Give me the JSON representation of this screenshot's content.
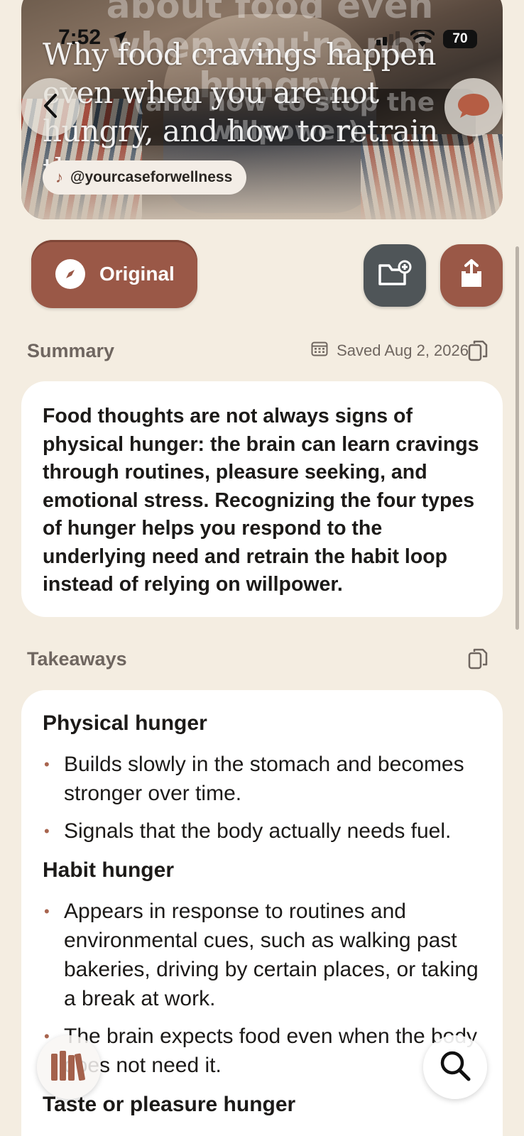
{
  "status_bar": {
    "time": "7:52",
    "battery": "70"
  },
  "hero": {
    "overlay_caption_top": "about food even when you're not hungry",
    "overlay_caption_bottom": "(and how to stop the willpower)",
    "title": "Why food cravings happen even when you are not hungry, and how to retrain them",
    "handle": "@yourcaseforwellness"
  },
  "actions": {
    "original_label": "Original"
  },
  "summary": {
    "heading": "Summary",
    "saved": "Saved Aug 2, 2026",
    "text": "Food thoughts are not always signs of physical hunger: the brain can learn cravings through routines, pleasure seeking, and emotional stress. Recognizing the four types of hunger helps you respond to the underlying need and retrain the habit loop instead of relying on willpower."
  },
  "takeaways": {
    "heading": "Takeaways",
    "sections": [
      {
        "title": "Physical hunger",
        "bullets": [
          "Builds slowly in the stomach and becomes stronger over time.",
          "Signals that the body actually needs fuel."
        ]
      },
      {
        "title": "Habit hunger",
        "bullets": [
          "Appears in response to routines and environmental cues, such as walking past bakeries, driving by certain places, or taking a break at work.",
          "The brain expects food even when the body does not need it."
        ]
      },
      {
        "title": "Taste or pleasure hunger",
        "bullets": []
      }
    ]
  },
  "icons": {
    "back": "chevron-left-icon",
    "chat": "chat-bubble-icon",
    "compass": "compass-icon",
    "folder": "folder-add-icon",
    "share": "share-icon",
    "calendar": "calendar-icon",
    "copy": "copy-icon",
    "library": "library-books-icon",
    "search": "search-icon",
    "music": "music-note-icon"
  },
  "colors": {
    "accent": "#9a5847",
    "background": "#f4ede1",
    "folder_button": "#4f5558"
  }
}
